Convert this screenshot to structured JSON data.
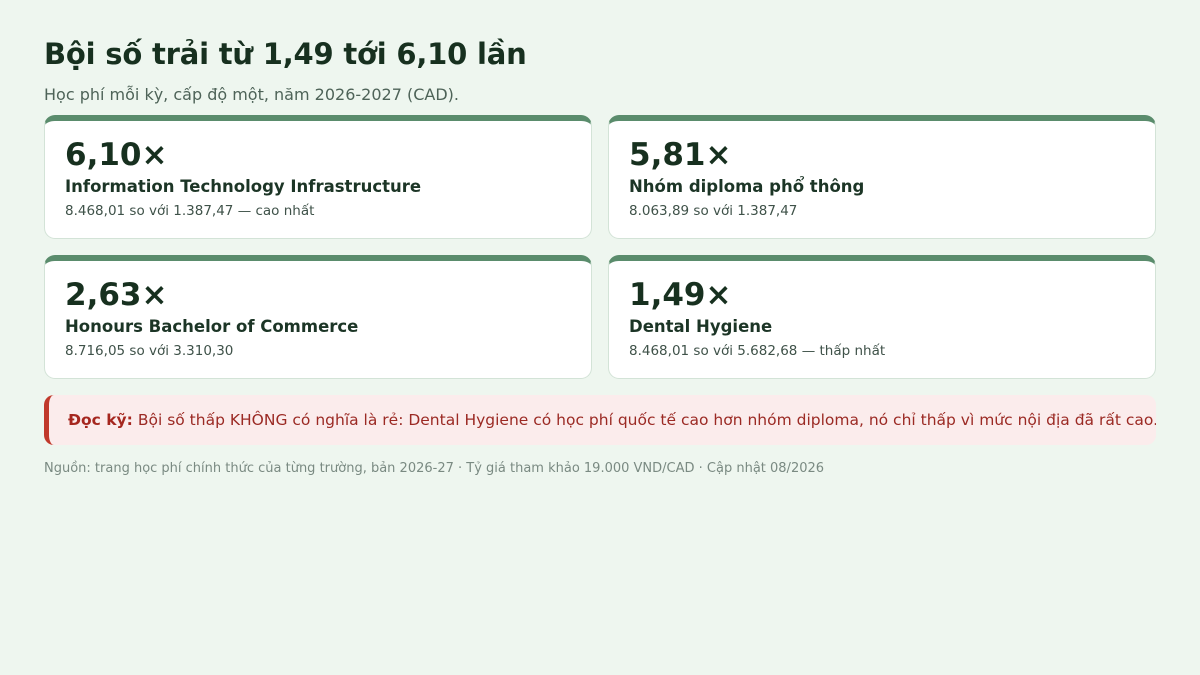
{
  "header": {
    "title": "Bội số trải từ 1,49 tới 6,10 lần",
    "subtitle": "Học phí mỗi kỳ, cấp độ một, năm 2026-2027 (CAD)."
  },
  "cards": [
    {
      "value": "6,10×",
      "label": "Information Technology Infrastructure",
      "detail": "8.468,01 so với 1.387,47 — cao nhất"
    },
    {
      "value": "5,81×",
      "label": "Nhóm diploma phổ thông",
      "detail": "8.063,89 so với 1.387,47"
    },
    {
      "value": "2,63×",
      "label": "Honours Bachelor of Commerce",
      "detail": "8.716,05 so với 3.310,30"
    },
    {
      "value": "1,49×",
      "label": "Dental Hygiene",
      "detail": "8.468,01 so với 5.682,68 — thấp nhất"
    }
  ],
  "warning": {
    "label": "Đọc kỹ:",
    "text": "Bội số thấp KHÔNG có nghĩa là rẻ: Dental Hygiene có học phí quốc tế cao hơn nhóm diploma, nó chỉ thấp vì mức nội địa đã rất cao."
  },
  "footer": {
    "source": "Nguồn: trang học phí chính thức của từng trường, bản 2026-27 · Tỷ giá tham khảo 19.000 VND/CAD · Cập nhật 08/2026"
  },
  "colors": {
    "background": "#eef6ef",
    "card_accent": "#5a8c6c",
    "warning_accent": "#c0392b",
    "warning_background": "#fbecec"
  }
}
